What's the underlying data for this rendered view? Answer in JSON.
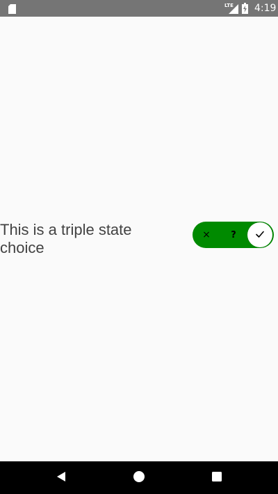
{
  "status_bar": {
    "time": "4:19",
    "network_label": "LTE",
    "colors": {
      "background": "#757575",
      "foreground": "#ffffff"
    },
    "icons": [
      "sd-card-icon",
      "lte-signal-icon",
      "battery-charging-icon"
    ]
  },
  "setting": {
    "label": "This is a triple state choice",
    "switch": {
      "options": [
        {
          "symbol": "×",
          "icon": "close-icon"
        },
        {
          "symbol": "?",
          "icon": "question-icon"
        },
        {
          "symbol": "✓",
          "icon": "check-icon"
        }
      ],
      "selected_index": 2,
      "colors": {
        "track": "#008a00",
        "thumb": "#ffffff"
      }
    }
  },
  "nav_bar": {
    "background": "#000000",
    "icons": [
      "back-icon",
      "home-icon",
      "recents-icon"
    ]
  }
}
